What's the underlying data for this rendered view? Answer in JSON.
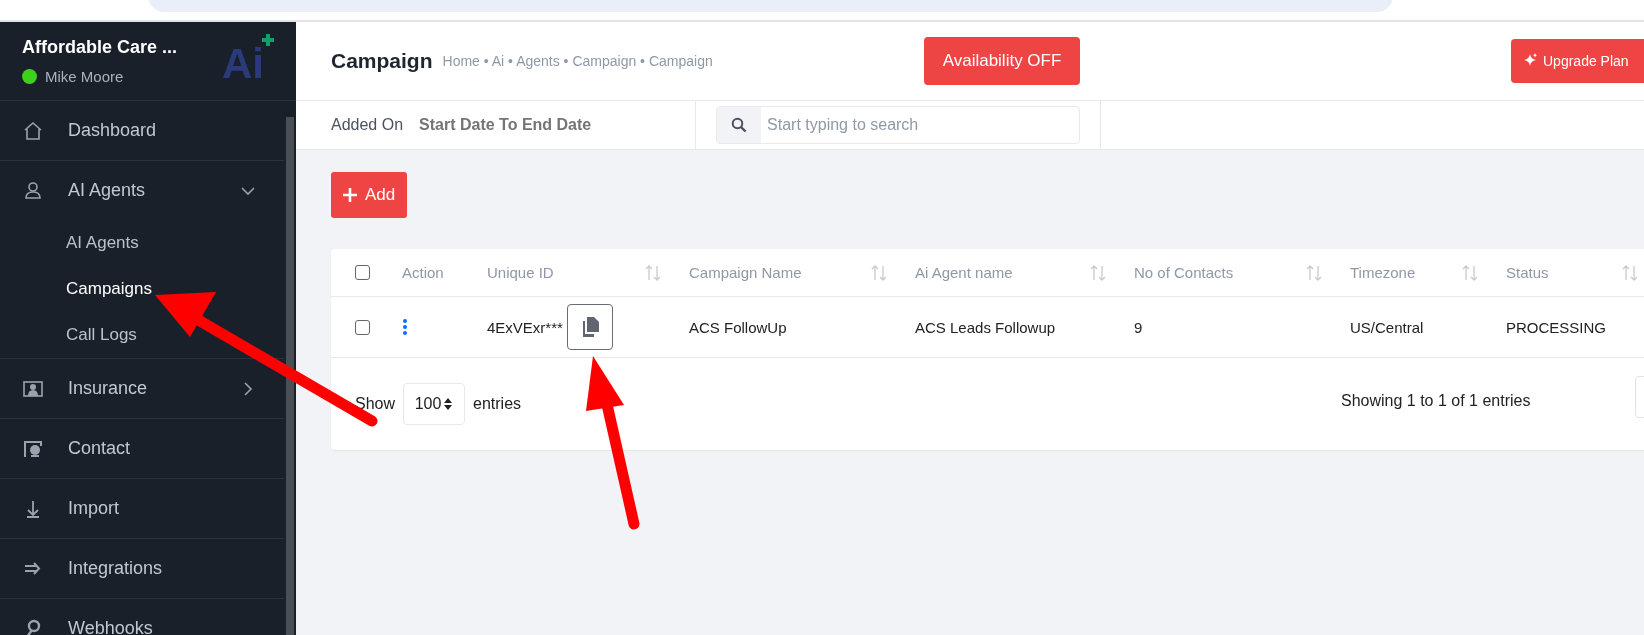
{
  "sidebar": {
    "org_name": "Affordable Care ...",
    "user": "Mike Moore",
    "online": true,
    "logo": "Ai",
    "items": [
      {
        "label": "Dashboard",
        "kind": "link"
      },
      {
        "label": "AI Agents",
        "kind": "group",
        "expanded": true,
        "children": [
          {
            "label": "AI Agents",
            "selected": false
          },
          {
            "label": "Campaigns",
            "selected": true
          },
          {
            "label": "Call Logs",
            "selected": false
          }
        ]
      },
      {
        "label": "Insurance",
        "kind": "group",
        "expanded": false
      },
      {
        "label": "Contact",
        "kind": "link"
      },
      {
        "label": "Import",
        "kind": "link"
      },
      {
        "label": "Integrations",
        "kind": "link"
      },
      {
        "label": "Webhooks",
        "kind": "link"
      }
    ]
  },
  "header": {
    "title": "Campaign",
    "breadcrumb": "Home • Ai • Agents • Campaign • Campaign",
    "availability_button": "Availability OFF",
    "upgrade_button": "Upgrade Plan"
  },
  "filters": {
    "label": "Added On",
    "date_placeholder": "Start Date To End Date",
    "search_placeholder": "Start typing to search"
  },
  "add_button": "Add",
  "table": {
    "select_all_checked": false,
    "columns": [
      {
        "label": "Action",
        "sortable": false
      },
      {
        "label": "Unique ID",
        "sortable": true
      },
      {
        "label": "Campaign Name",
        "sortable": true
      },
      {
        "label": "Ai Agent name",
        "sortable": true
      },
      {
        "label": "No of Contacts",
        "sortable": true
      },
      {
        "label": "Timezone",
        "sortable": true
      },
      {
        "label": "Status",
        "sortable": true
      }
    ],
    "rows": [
      {
        "checked": false,
        "unique_id": "4ExVExr***",
        "campaign_name": "ACS FollowUp",
        "agent_name": "ACS Leads Followup",
        "contacts": "9",
        "timezone": "US/Central",
        "status": "PROCESSING"
      }
    ],
    "show_label": "Show",
    "page_size": "100",
    "entries_label": "entries",
    "summary": "Showing 1 to 1 of 1 entries"
  }
}
